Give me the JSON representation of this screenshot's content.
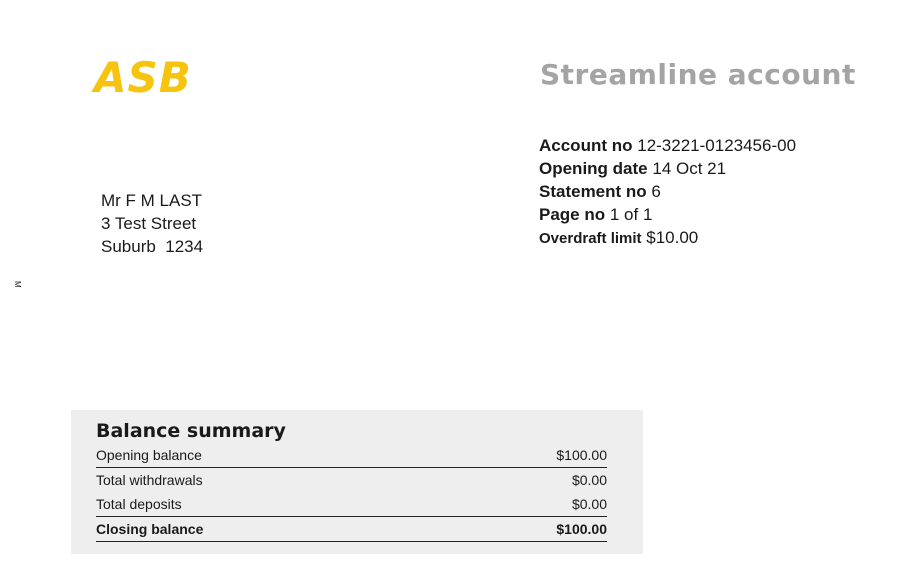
{
  "header": {
    "logo_text": "ASB",
    "title": "Streamline account",
    "brand_color": "#f6c30e",
    "title_color": "#a4a4a4"
  },
  "account_info": {
    "account_no_label": "Account no",
    "account_no": "12-3221-0123456-00",
    "opening_date_label": "Opening date",
    "opening_date": "14 Oct 21",
    "statement_no_label": "Statement no",
    "statement_no": "6",
    "page_no_label": "Page no",
    "page_no": "1 of 1",
    "overdraft_label": "Overdraft limit",
    "overdraft": "$10.00"
  },
  "address": {
    "line1": "Mr F M LAST",
    "line2": "3 Test Street",
    "line3": "Suburb  1234"
  },
  "side_mark": "M",
  "balance_summary": {
    "title": "Balance summary",
    "rows": [
      {
        "label": "Opening balance",
        "value": "$100.00"
      },
      {
        "label": "Total withdrawals",
        "value": "$0.00"
      },
      {
        "label": "Total deposits",
        "value": "$0.00"
      },
      {
        "label": "Closing balance",
        "value": "$100.00"
      }
    ]
  }
}
